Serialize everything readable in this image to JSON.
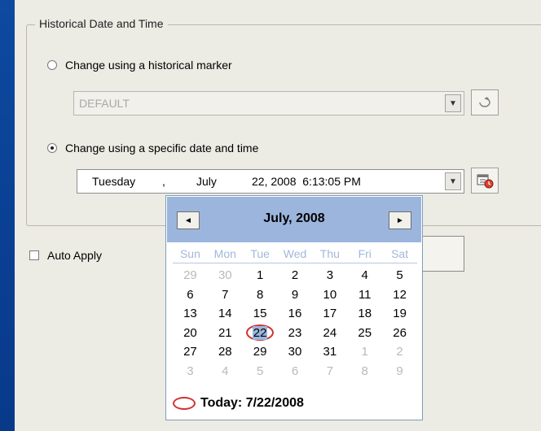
{
  "group": {
    "title": "Historical Date and Time"
  },
  "radio_marker": {
    "label": "Change using a historical marker",
    "checked": false
  },
  "marker_combo": {
    "value": "DEFAULT",
    "enabled": false
  },
  "radio_specific": {
    "label": "Change using a specific date and time",
    "checked": true
  },
  "datetime_picker": {
    "weekday": "Tuesday",
    "separator": ",",
    "month": "July",
    "date_time": "22, 2008  6:13:05 PM"
  },
  "auto_apply": {
    "label": "Auto Apply",
    "checked": false
  },
  "calendar": {
    "month_title": "July, 2008",
    "prev_label": "◄",
    "next_label": "►",
    "days_of_week": [
      "Sun",
      "Mon",
      "Tue",
      "Wed",
      "Thu",
      "Fri",
      "Sat"
    ],
    "weeks": [
      [
        "29",
        "30",
        "1",
        "2",
        "3",
        "4",
        "5"
      ],
      [
        "6",
        "7",
        "8",
        "9",
        "10",
        "11",
        "12"
      ],
      [
        "13",
        "14",
        "15",
        "16",
        "17",
        "18",
        "19"
      ],
      [
        "20",
        "21",
        "22",
        "23",
        "24",
        "25",
        "26"
      ],
      [
        "27",
        "28",
        "29",
        "30",
        "31",
        "1",
        "2"
      ],
      [
        "3",
        "4",
        "5",
        "6",
        "7",
        "8",
        "9"
      ]
    ],
    "selected_day": "22",
    "today_text": "Today: 7/22/2008"
  },
  "colors": {
    "background": "#0a3f93",
    "dialog": "#ecebe4",
    "calendar_header": "#9bb5dd",
    "highlight_circle": "#d23232"
  }
}
